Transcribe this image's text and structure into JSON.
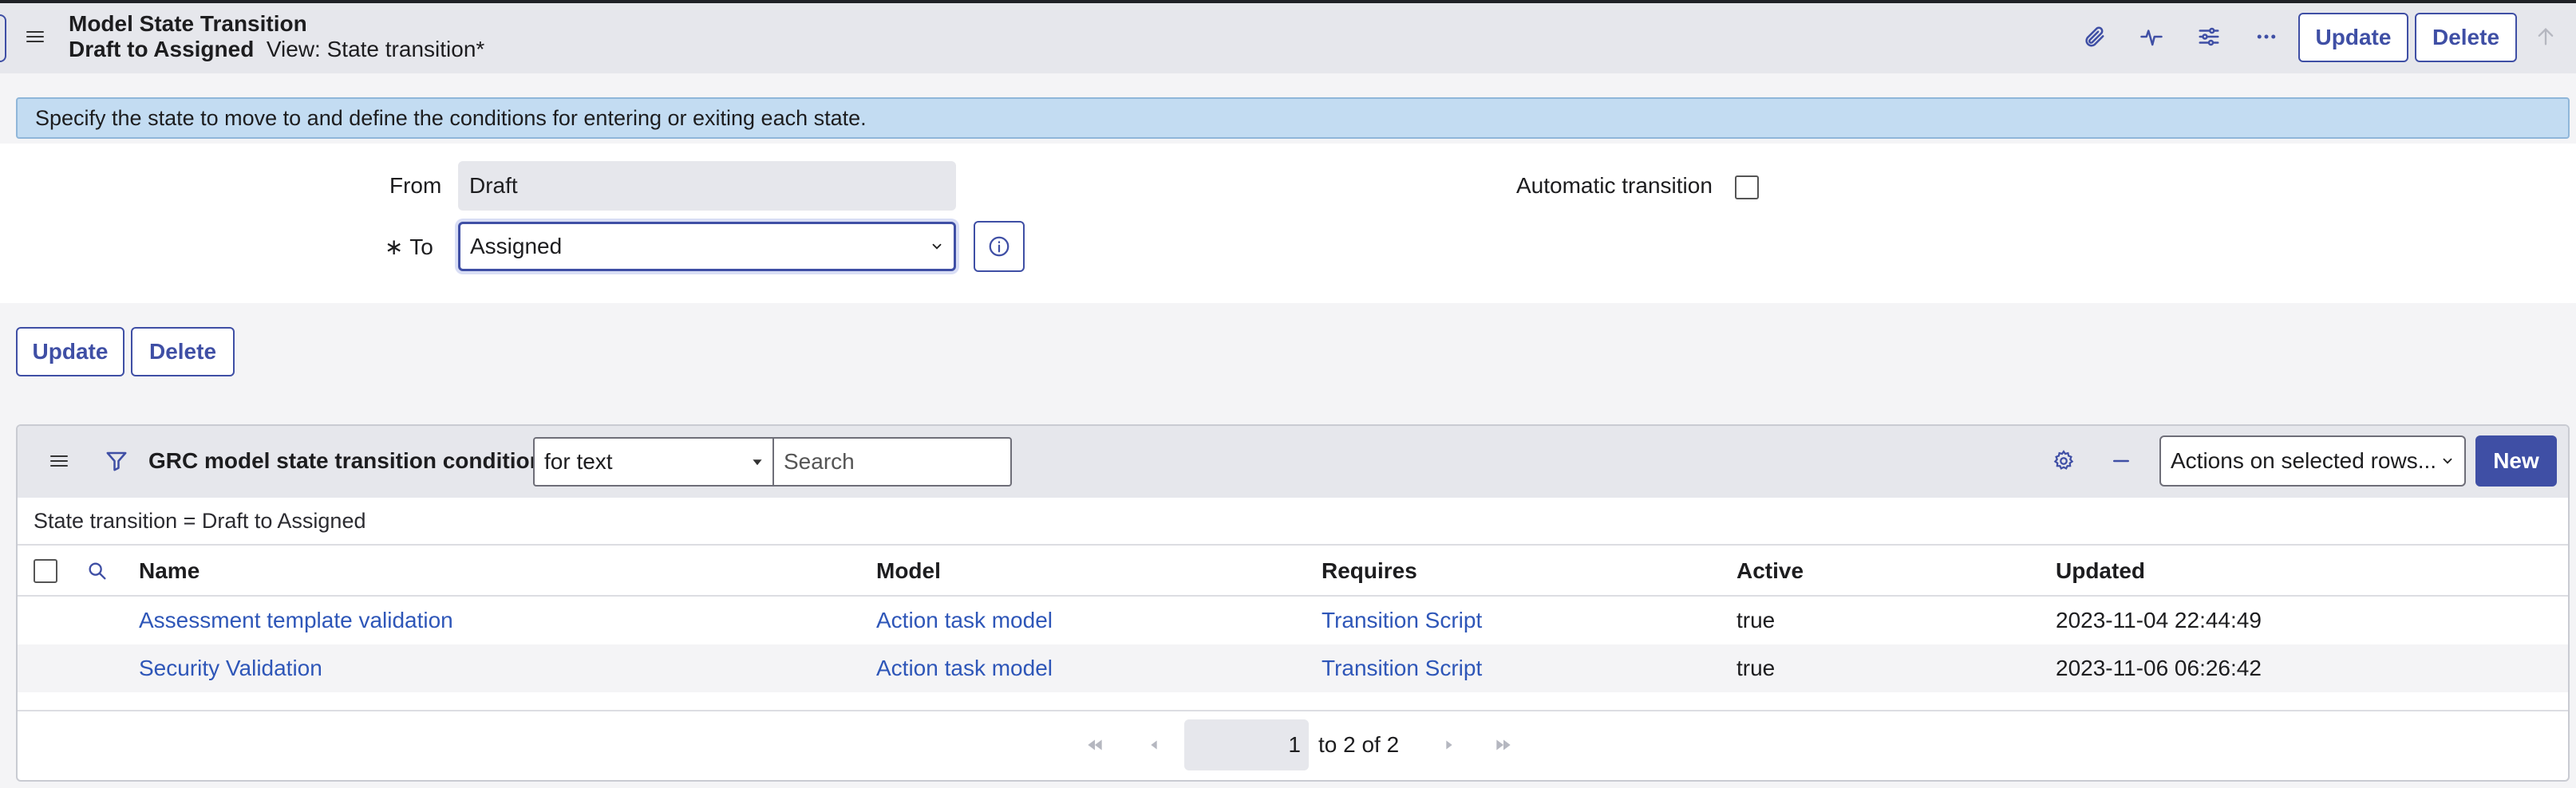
{
  "header": {
    "title": "Model State Transition",
    "record_name": "Draft to Assigned",
    "view_label": "View: State transition*",
    "update_label": "Update",
    "delete_label": "Delete"
  },
  "banner": {
    "text": "Specify the state to move to and define the conditions for entering or exiting each state."
  },
  "form": {
    "from_label": "From",
    "from_value": "Draft",
    "to_required_mark": "∗",
    "to_label": "To",
    "to_value": "Assigned",
    "auto_transition_label": "Automatic transition",
    "auto_transition_checked": false
  },
  "form_actions": {
    "update_label": "Update",
    "delete_label": "Delete"
  },
  "related_list": {
    "title": "GRC model state transition conditions",
    "search_field_value": "for text",
    "search_placeholder": "Search",
    "actions_value": "Actions on selected rows...",
    "new_label": "New",
    "breadcrumb": "State transition = Draft to Assigned",
    "columns": [
      "Name",
      "Model",
      "Requires",
      "Active",
      "Updated"
    ],
    "rows": [
      {
        "name": "Assessment template validation",
        "model": "Action task model",
        "requires": "Transition Script",
        "active": "true",
        "updated": "2023-11-04 22:44:49"
      },
      {
        "name": "Security Validation",
        "model": "Action task model",
        "requires": "Transition Script",
        "active": "true",
        "updated": "2023-11-06 06:26:42"
      }
    ],
    "pagination": {
      "current_page": "1",
      "range_text": "to 2 of 2"
    }
  },
  "colors": {
    "accent": "#3f4fa5",
    "link": "#2e56b8",
    "banner_bg": "#c3dcf2",
    "header_bg": "#e6e7ec"
  },
  "icons": {
    "header": [
      "menu-icon",
      "paperclip-icon",
      "activity-icon",
      "sliders-icon",
      "more-icon",
      "scroll-up-icon"
    ],
    "list": [
      "menu-icon",
      "filter-icon",
      "gear-icon",
      "minimize-icon",
      "search-icon"
    ],
    "pager": [
      "first-page-icon",
      "prev-page-icon",
      "next-page-icon",
      "last-page-icon"
    ]
  }
}
